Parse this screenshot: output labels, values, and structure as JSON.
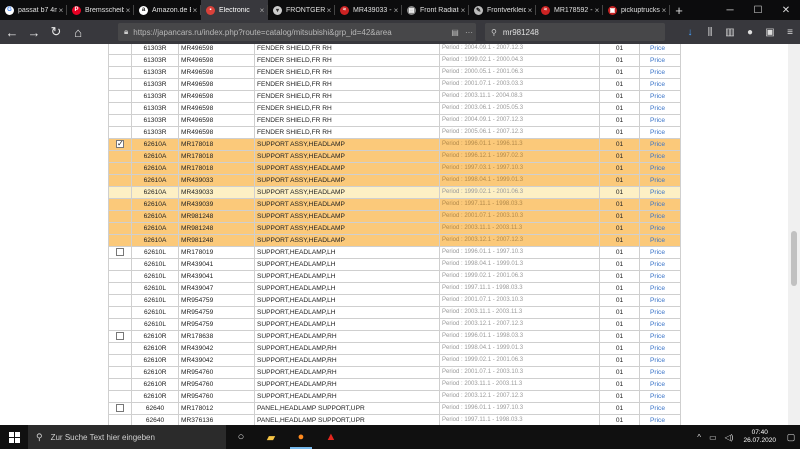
{
  "browser": {
    "tabs": [
      {
        "label": "passat b7 4mot",
        "icon": "google-icon",
        "color": "#ffffff",
        "glyph": "G",
        "glyph_color": "#4285f4"
      },
      {
        "label": "Bremsscheibe",
        "icon": "pinterest-icon",
        "color": "#e60023",
        "glyph": "P",
        "glyph_color": "#ffffff"
      },
      {
        "label": "Amazon.de Ein",
        "icon": "amazon-icon",
        "color": "#ffffff",
        "glyph": "a",
        "glyph_color": "#111111"
      },
      {
        "label": "Electronic",
        "icon": "document-icon",
        "color": "#d9413a",
        "glyph": "▪",
        "glyph_color": "#ffffff",
        "active": true
      },
      {
        "label": "FRONTGERÜS",
        "icon": "bookmark-icon",
        "color": "#cccccc",
        "glyph": "▾",
        "glyph_color": "#333333"
      },
      {
        "label": "MR439033 - Pa",
        "icon": "site-icon",
        "color": "#cc2222",
        "glyph": "≈",
        "glyph_color": "#ffffff"
      },
      {
        "label": "Front Radiator",
        "icon": "page-icon",
        "color": "#888888",
        "glyph": "▤",
        "glyph_color": "#ffffff"
      },
      {
        "label": "Frontverkleid",
        "icon": "tool-icon",
        "color": "#bbbbbb",
        "glyph": "✎",
        "glyph_color": "#222222"
      },
      {
        "label": "MR178592 - Pa",
        "icon": "site-icon",
        "color": "#cc2222",
        "glyph": "≈",
        "glyph_color": "#ffffff"
      },
      {
        "label": "pickuptrucks",
        "icon": "site-icon",
        "color": "#c42222",
        "glyph": "▣",
        "glyph_color": "#ffffff"
      }
    ],
    "url": "https://japancars.ru/index.php?route=catalog/mitsubishi&grp_id=42&area",
    "search_value": "mr981248"
  },
  "table": {
    "price_label": "Price",
    "rows": [
      {
        "code": "61303R",
        "part": "MR496598",
        "name": "FENDER SHIELD,FR RH",
        "period": "Period : 2004.09.1 - 2007.12.3",
        "qty": "01",
        "checkbox": false,
        "hl": ""
      },
      {
        "code": "61303R",
        "part": "MR496598",
        "name": "FENDER SHIELD,FR RH",
        "period": "Period : 1999.02.1 - 2000.04.3",
        "qty": "01",
        "checkbox": false,
        "hl": ""
      },
      {
        "code": "61303R",
        "part": "MR496598",
        "name": "FENDER SHIELD,FR RH",
        "period": "Period : 2000.05.1 - 2001.06.3",
        "qty": "01",
        "checkbox": false,
        "hl": ""
      },
      {
        "code": "61303R",
        "part": "MR496598",
        "name": "FENDER SHIELD,FR RH",
        "period": "Period : 2001.07.1 - 2003.03.3",
        "qty": "01",
        "checkbox": false,
        "hl": ""
      },
      {
        "code": "61303R",
        "part": "MR496598",
        "name": "FENDER SHIELD,FR RH",
        "period": "Period : 2003.11.1 - 2004.08.3",
        "qty": "01",
        "checkbox": false,
        "hl": ""
      },
      {
        "code": "61303R",
        "part": "MR496598",
        "name": "FENDER SHIELD,FR RH",
        "period": "Period : 2003.06.1 - 2005.05.3",
        "qty": "01",
        "checkbox": false,
        "hl": ""
      },
      {
        "code": "61303R",
        "part": "MR496598",
        "name": "FENDER SHIELD,FR RH",
        "period": "Period : 2004.09.1 - 2007.12.3",
        "qty": "01",
        "checkbox": false,
        "hl": ""
      },
      {
        "code": "61303R",
        "part": "MR496598",
        "name": "FENDER SHIELD,FR RH",
        "period": "Period : 2005.06.1 - 2007.12.3",
        "qty": "01",
        "checkbox": false,
        "hl": ""
      },
      {
        "code": "62610A",
        "part": "MR178018",
        "name": "SUPPORT ASSY,HEADLAMP",
        "period": "Period : 1996.01.1 - 1996.11.3",
        "qty": "01",
        "checkbox": true,
        "checked": true,
        "hl": "hl",
        "sep": true
      },
      {
        "code": "62610A",
        "part": "MR178018",
        "name": "SUPPORT ASSY,HEADLAMP",
        "period": "Period : 1996.12.1 - 1997.02.3",
        "qty": "01",
        "checkbox": false,
        "hl": "hl"
      },
      {
        "code": "62610A",
        "part": "MR178018",
        "name": "SUPPORT ASSY,HEADLAMP",
        "period": "Period : 1997.03.1 - 1997.10.3",
        "qty": "01",
        "checkbox": false,
        "hl": "hl"
      },
      {
        "code": "62610A",
        "part": "MR439033",
        "name": "SUPPORT ASSY,HEADLAMP",
        "period": "Period : 1998.04.1 - 1999.01.3",
        "qty": "01",
        "checkbox": false,
        "hl": "hl"
      },
      {
        "code": "62610A",
        "part": "MR439033",
        "name": "SUPPORT ASSY,HEADLAMP",
        "period": "Period : 1999.02.1 - 2001.06.3",
        "qty": "01",
        "checkbox": false,
        "hl": "hl-light"
      },
      {
        "code": "62610A",
        "part": "MR439039",
        "name": "SUPPORT ASSY,HEADLAMP",
        "period": "Period : 1997.11.1 - 1998.03.3",
        "qty": "01",
        "checkbox": false,
        "hl": "hl"
      },
      {
        "code": "62610A",
        "part": "MR981248",
        "name": "SUPPORT ASSY,HEADLAMP",
        "period": "Period : 2001.07.1 - 2003.10.3",
        "qty": "01",
        "checkbox": false,
        "hl": "hl"
      },
      {
        "code": "62610A",
        "part": "MR981248",
        "name": "SUPPORT ASSY,HEADLAMP",
        "period": "Period : 2003.11.1 - 2003.11.3",
        "qty": "01",
        "checkbox": false,
        "hl": "hl"
      },
      {
        "code": "62610A",
        "part": "MR981248",
        "name": "SUPPORT ASSY,HEADLAMP",
        "period": "Period : 2003.12.1 - 2007.12.3",
        "qty": "01",
        "checkbox": false,
        "hl": "hl"
      },
      {
        "code": "62610L",
        "part": "MR178019",
        "name": "SUPPORT,HEADLAMP,LH",
        "period": "Period : 1996.01.1 - 1997.10.3",
        "qty": "01",
        "checkbox": true,
        "checked": false,
        "hl": "",
        "sep": true
      },
      {
        "code": "62610L",
        "part": "MR439041",
        "name": "SUPPORT,HEADLAMP,LH",
        "period": "Period : 1998.04.1 - 1999.01.3",
        "qty": "01",
        "checkbox": false,
        "hl": ""
      },
      {
        "code": "62610L",
        "part": "MR439041",
        "name": "SUPPORT,HEADLAMP,LH",
        "period": "Period : 1999.02.1 - 2001.06.3",
        "qty": "01",
        "checkbox": false,
        "hl": ""
      },
      {
        "code": "62610L",
        "part": "MR439047",
        "name": "SUPPORT,HEADLAMP,LH",
        "period": "Period : 1997.11.1 - 1998.03.3",
        "qty": "01",
        "checkbox": false,
        "hl": ""
      },
      {
        "code": "62610L",
        "part": "MR954759",
        "name": "SUPPORT,HEADLAMP,LH",
        "period": "Period : 2001.07.1 - 2003.10.3",
        "qty": "01",
        "checkbox": false,
        "hl": ""
      },
      {
        "code": "62610L",
        "part": "MR954759",
        "name": "SUPPORT,HEADLAMP,LH",
        "period": "Period : 2003.11.1 - 2003.11.3",
        "qty": "01",
        "checkbox": false,
        "hl": ""
      },
      {
        "code": "62610L",
        "part": "MR954759",
        "name": "SUPPORT,HEADLAMP,LH",
        "period": "Period : 2003.12.1 - 2007.12.3",
        "qty": "01",
        "checkbox": false,
        "hl": ""
      },
      {
        "code": "62610R",
        "part": "MR178638",
        "name": "SUPPORT,HEADLAMP,RH",
        "period": "Period : 1996.01.1 - 1998.03.3",
        "qty": "01",
        "checkbox": true,
        "checked": false,
        "hl": "",
        "sep": true
      },
      {
        "code": "62610R",
        "part": "MR439042",
        "name": "SUPPORT,HEADLAMP,RH",
        "period": "Period : 1998.04.1 - 1999.01.3",
        "qty": "01",
        "checkbox": false,
        "hl": ""
      },
      {
        "code": "62610R",
        "part": "MR439042",
        "name": "SUPPORT,HEADLAMP,RH",
        "period": "Period : 1999.02.1 - 2001.06.3",
        "qty": "01",
        "checkbox": false,
        "hl": ""
      },
      {
        "code": "62610R",
        "part": "MR954760",
        "name": "SUPPORT,HEADLAMP,RH",
        "period": "Period : 2001.07.1 - 2003.10.3",
        "qty": "01",
        "checkbox": false,
        "hl": ""
      },
      {
        "code": "62610R",
        "part": "MR954760",
        "name": "SUPPORT,HEADLAMP,RH",
        "period": "Period : 2003.11.1 - 2003.11.3",
        "qty": "01",
        "checkbox": false,
        "hl": ""
      },
      {
        "code": "62610R",
        "part": "MR954760",
        "name": "SUPPORT,HEADLAMP,RH",
        "period": "Period : 2003.12.1 - 2007.12.3",
        "qty": "01",
        "checkbox": false,
        "hl": ""
      },
      {
        "code": "62640",
        "part": "MR178012",
        "name": "PANEL,HEADLAMP SUPPORT,UPR",
        "period": "Period : 1996.01.1 - 1997.10.3",
        "qty": "01",
        "checkbox": true,
        "checked": false,
        "hl": "",
        "sep": true
      },
      {
        "code": "62640",
        "part": "MR376136",
        "name": "PANEL,HEADLAMP SUPPORT,UPR",
        "period": "Period : 1997.11.1 - 1998.03.3",
        "qty": "01",
        "checkbox": false,
        "hl": ""
      }
    ]
  },
  "taskbar": {
    "search_placeholder": "Zur Suche Text hier eingeben",
    "time": "07:40",
    "date": "26.07.2020"
  },
  "colors": {
    "highlight": "#fbc97a",
    "highlight_light": "#fdf0c4",
    "link": "#3a74c8"
  }
}
